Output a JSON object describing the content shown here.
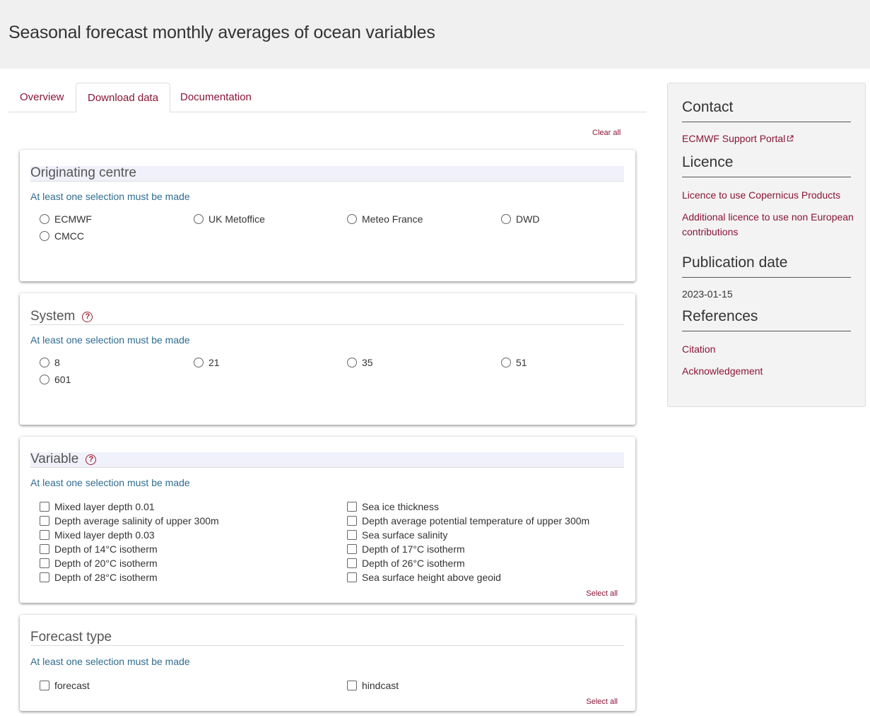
{
  "page": {
    "title": "Seasonal forecast monthly averages of ocean variables"
  },
  "tabs": [
    {
      "label": "Overview"
    },
    {
      "label": "Download data"
    },
    {
      "label": "Documentation"
    }
  ],
  "form": {
    "clear_all": "Clear all",
    "originating_centre": {
      "title": "Originating centre",
      "hint": "At least one selection must be made",
      "options": [
        "ECMWF",
        "UK Metoffice",
        "Meteo France",
        "DWD",
        "CMCC"
      ]
    },
    "system": {
      "title": "System",
      "hint": "At least one selection must be made",
      "options": [
        "8",
        "21",
        "35",
        "51",
        "601"
      ]
    },
    "variable": {
      "title": "Variable",
      "hint": "At least one selection must be made",
      "options": [
        "Mixed layer depth 0.01",
        "Sea ice thickness",
        "Depth average salinity of upper 300m",
        "Depth average potential temperature of upper 300m",
        "Mixed layer depth 0.03",
        "Sea surface salinity",
        "Depth of 14°C isotherm",
        "Depth of 17°C isotherm",
        "Depth of 20°C isotherm",
        "Depth of 26°C isotherm",
        "Depth of 28°C isotherm",
        "Sea surface height above geoid"
      ],
      "select_all": "Select all"
    },
    "forecast_type": {
      "title": "Forecast type",
      "hint": "At least one selection must be made",
      "options": [
        "forecast",
        "hindcast"
      ],
      "select_all": "Select all"
    }
  },
  "sidebar": {
    "contact": {
      "heading": "Contact",
      "link": "ECMWF Support Portal"
    },
    "licence": {
      "heading": "Licence",
      "links": [
        "Licence to use Copernicus Products",
        "Additional licence to use non European contributions"
      ]
    },
    "publication": {
      "heading": "Publication date",
      "date": "2023-01-15"
    },
    "references": {
      "heading": "References",
      "links": [
        "Citation",
        "Acknowledgement"
      ]
    }
  },
  "colors": {
    "accent": "#8a1538",
    "hint": "#2f6c8f",
    "header_bg": "#f0f0f0"
  }
}
